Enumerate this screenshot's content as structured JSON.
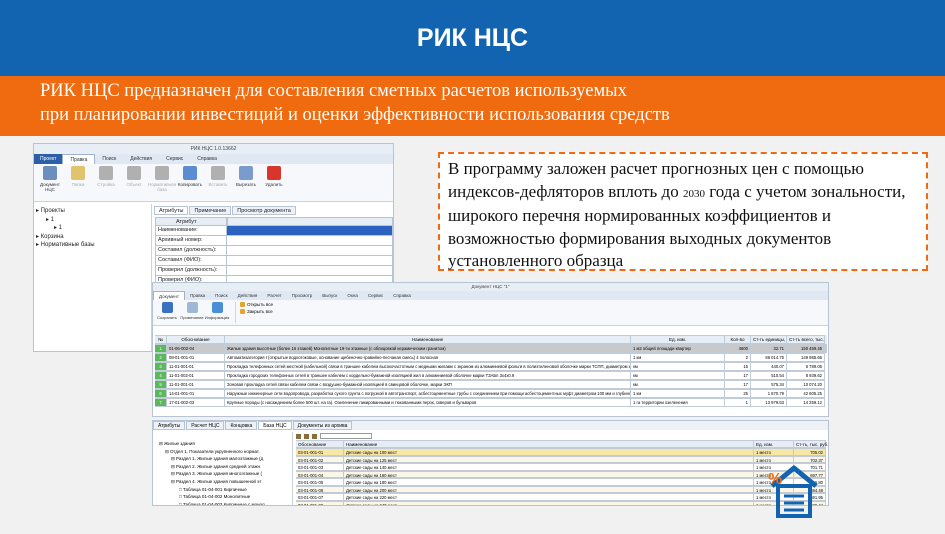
{
  "title": "РИК НЦС",
  "subtitle": {
    "line1": "РИК НЦС предназначен для составления сметных расчетов используемых",
    "line2": "при планировании инвестиций и оценки эффективности использования средств"
  },
  "callout": {
    "part1": "В программу заложен расчет прогнозных цен с помощью индексов-дефляторов вплоть до ",
    "year": "2030",
    "part2": " года с учетом зональности, широкого перечня нормированных коэффициентов и возможностью формирования выходных документов установленного образца"
  },
  "colors": {
    "title_bg": "#1264b0",
    "accent": "#f06a10"
  },
  "win1": {
    "caption": "РИК НЦС 1.0.13662",
    "menu": [
      "Проект",
      "Правка",
      "Поиск",
      "Действия",
      "Сервис",
      "Справка"
    ],
    "ribbon": [
      {
        "label": "Документ НЦС",
        "icon": "document-icon",
        "disabled": false
      },
      {
        "label": "Папка",
        "icon": "folder-icon",
        "disabled": true
      },
      {
        "label": "Стройка",
        "icon": "building-icon",
        "disabled": true
      },
      {
        "label": "Объект",
        "icon": "object-icon",
        "disabled": true
      },
      {
        "label": "Нормативная база",
        "icon": "database-icon",
        "disabled": true
      },
      {
        "label": "Копировать",
        "icon": "copy-icon",
        "disabled": false
      },
      {
        "label": "Вставить",
        "icon": "paste-icon",
        "disabled": true
      },
      {
        "label": "Вырезать",
        "icon": "cut-icon",
        "disabled": false
      },
      {
        "label": "Удалить",
        "icon": "delete-icon",
        "disabled": false
      }
    ],
    "group_add": "Добавить",
    "group_clipboard": "Буфер обмена",
    "tree": [
      "Проекты",
      "1",
      "1",
      "Корзина",
      "Нормативные базы"
    ],
    "tabs": [
      "Атрибуты",
      "Примечание",
      "Просмотр документа"
    ],
    "attr_header": "Атрибут",
    "attrs": [
      "Наименование:",
      "Архивный номер:",
      "Составил (должность):",
      "Составил (ФИО):",
      "Проверил (должность):",
      "Проверил (ФИО):"
    ]
  },
  "win2": {
    "caption": "Документ НЦС \"1\"",
    "menu": [
      "Документ",
      "Правка",
      "Поиск",
      "Действия",
      "Расчет",
      "Просмотр",
      "Выпуск",
      "Окна",
      "Сервис",
      "Справка"
    ],
    "ribbon": [
      {
        "label": "Сохранить",
        "icon": "save-icon"
      },
      {
        "label": "Примечание",
        "icon": "note-icon"
      },
      {
        "label": "Информация",
        "icon": "info-icon"
      }
    ],
    "small_buttons": [
      "Открыть все",
      "Закрыть все"
    ],
    "group_doc": "Документ",
    "group_view": "Вид",
    "columns": [
      "№",
      "Обоснование",
      "Наименование",
      "Ед. изм.",
      "Кол-во",
      "Ст-ть единицы, тыс. руб.",
      "Ст-ть всего, тыс. руб."
    ],
    "rows": [
      {
        "n": "1",
        "code": "01-06-002-04",
        "name": "Жилые здания высотные (более 16 этажей) Монолитные 19-ти этажные (с облицовкой керамическим гранитом)",
        "unit": "1 м2 общей площади квартир",
        "qty": "4600",
        "price": "32.71",
        "sum": "150 459.45",
        "hl": true
      },
      {
        "n": "2",
        "code": "08-01-001-01",
        "name": "Автоматизатегория I (открытые водоотоковые, основание щебеночно-гравийно-песчаная смесь) 4 полосная",
        "unit": "1 км",
        "qty": "2",
        "price": "86 014.75",
        "sum": "149 985.66",
        "hl": false
      },
      {
        "n": "3",
        "code": "11-01-001-01",
        "name": "Прокладка телефонных сетей местной (кабельной) связи в траншее кабелем высокочастотным с медными жилами с экраном из алюминиевой фольги в полиэтиленовой оболочке марки ТСПП, диаметром жилы 0,5 мм, с одной жилой",
        "unit": "км",
        "qty": "15",
        "price": "440.07",
        "sum": "6 789.05",
        "hl": false
      },
      {
        "n": "4",
        "code": "11-01-002-01",
        "name": "Прокладка городских телефонных сетей в траншее кабелем с кордельно-бумажной изоляцией жил в алюминиевой оболочке марки ТЗАБп 3х4х0.9",
        "unit": "км",
        "qty": "17",
        "price": "510.54",
        "sum": "8 939.62",
        "hl": false
      },
      {
        "n": "5",
        "code": "11-01-001-01",
        "name": "Зоновая прокладка сетей связи кабелем связи с воздушно-бумажной изоляцией в свинцовой оболочке, марки ЭКП",
        "unit": "км",
        "qty": "17",
        "price": "575.34",
        "sum": "10 074.20",
        "hl": false
      },
      {
        "n": "6",
        "code": "14-01-001-01",
        "name": "Наружные инженерные сети водопровода, разработка сухого грунта с погрузкой в автотранспорт, асбестоцементные трубы с соединением при помощи асбестоцементных муфт диаметром 100 мм и глубиной 2 м",
        "unit": "1 км",
        "qty": "25",
        "price": "1 670.79",
        "sum": "42 605.25",
        "hl": false
      },
      {
        "n": "7",
        "code": "17-01-002-03",
        "name": "Крупные породы (с насаждением более 500 шт. на га). Озеленение пикированными и тюкованными перок, скверов и бульваров",
        "unit": "1 га территории озеленения",
        "qty": "1",
        "price": "13 979.53",
        "sum": "14 259.12",
        "hl": false
      }
    ]
  },
  "win3": {
    "tabs": [
      "Атрибуты",
      "Расчет НЦС",
      "Концовка",
      "База НЦС",
      "Документы из архива"
    ],
    "tree": [
      "Жилые здания",
      "Отдел 1. Показатели укрупненного нормат.",
      "Раздел 1. Жилые здания малоэтажные (д",
      "Раздел 2. Жилые здания средней этажн",
      "Раздел 3. Жилые здания многоэтажные (",
      "Раздел 4. Жилые здания повышенной эт",
      "Таблица 01-04-001 Кирпичные",
      "Таблица 01-04-002 Монолитные",
      "Таблица 01-04-003 Кирпичные с монол",
      "Таблица 01-04-004 Кирпичные (с обли."
    ],
    "columns": [
      "Обоснование",
      "Наименование",
      "Ед. изм.",
      "Ст-ть, тыс. руб."
    ],
    "rows": [
      {
        "code": "03-01-001-01",
        "name": "Детские сады на 100 мест",
        "unit": "1 место",
        "sum": "705.02"
      },
      {
        "code": "03-01-001-02",
        "name": "Детские сады на 125 мест",
        "unit": "1 место",
        "sum": "702.37"
      },
      {
        "code": "03-01-001-03",
        "name": "Детские сады на 140 мест",
        "unit": "1 место",
        "sum": "701.71"
      },
      {
        "code": "03-01-001-04",
        "name": "Детские сады на 160 мест",
        "unit": "1 место",
        "sum": "697.77"
      },
      {
        "code": "03-01-001-05",
        "name": "Детские сады на 180 мест",
        "unit": "1 место",
        "sum": "696.80"
      },
      {
        "code": "03-01-001-06",
        "name": "Детские сады на 200 мест",
        "unit": "1 место",
        "sum": "694.48"
      },
      {
        "code": "03-01-001-07",
        "name": "Детские сады на 220 мест",
        "unit": "1 место",
        "sum": "691.95"
      },
      {
        "code": "03-01-001-08",
        "name": "Детские сады на 240 мест",
        "unit": "1 место",
        "sum": "689.44"
      }
    ]
  }
}
